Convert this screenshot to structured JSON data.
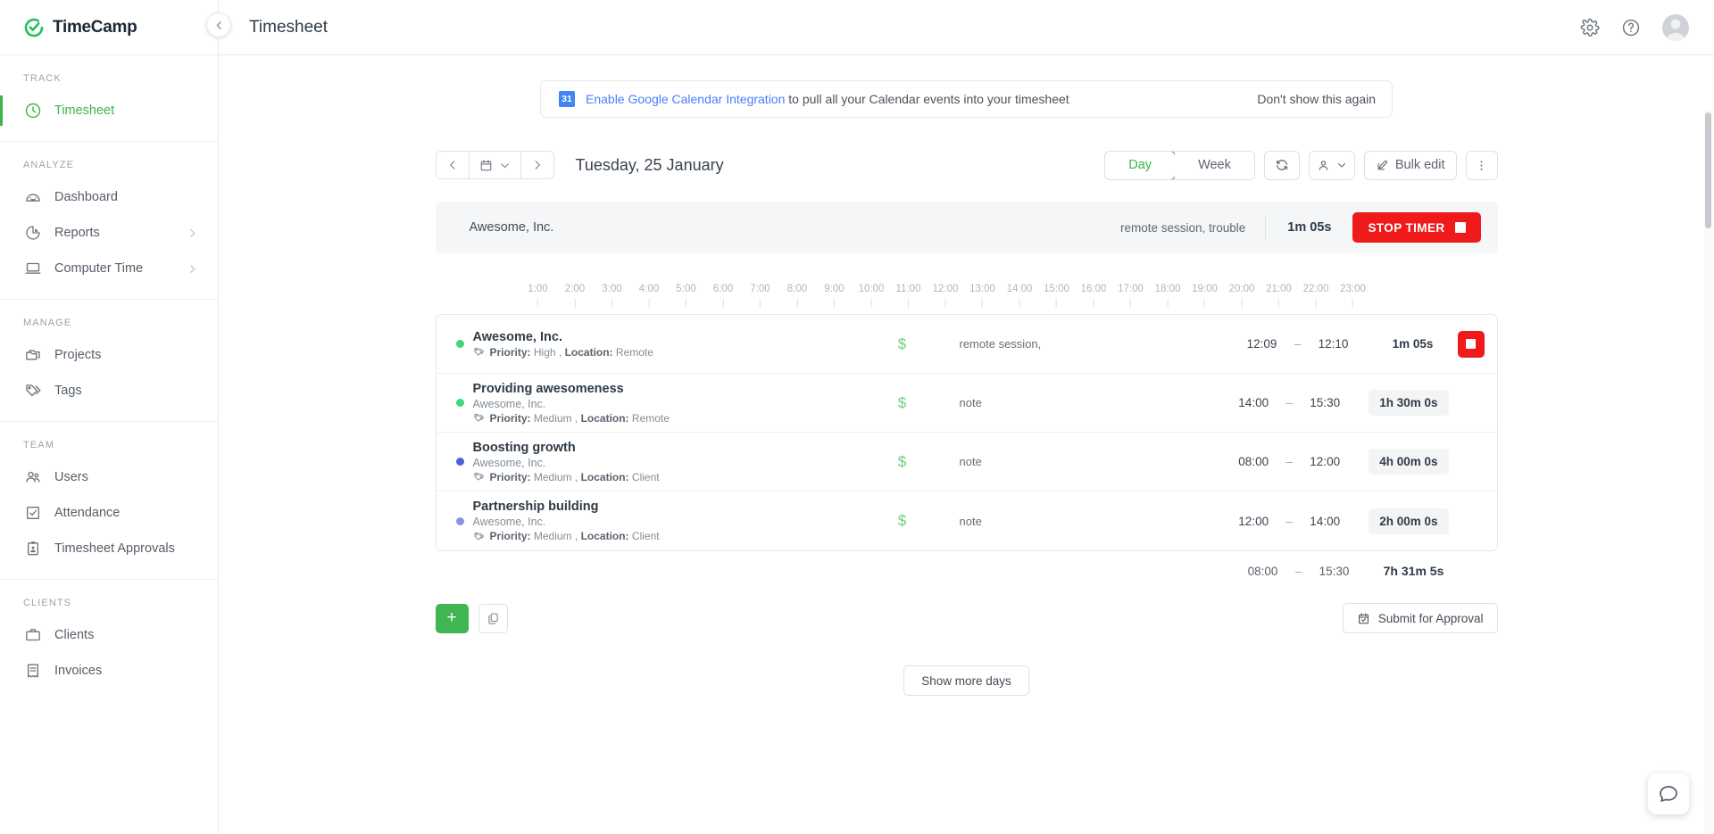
{
  "brand": {
    "name": "TimeCamp",
    "accent": "#3bb54a"
  },
  "sidebar": {
    "sections": [
      {
        "label": "TRACK",
        "items": [
          {
            "label": "Timesheet",
            "icon": "clock-icon",
            "active": true
          }
        ]
      },
      {
        "label": "ANALYZE",
        "items": [
          {
            "label": "Dashboard",
            "icon": "gauge-icon",
            "active": false
          },
          {
            "label": "Reports",
            "icon": "pie-chart-icon",
            "active": false,
            "chevron": true
          },
          {
            "label": "Computer Time",
            "icon": "laptop-icon",
            "active": false,
            "chevron": true
          }
        ]
      },
      {
        "label": "MANAGE",
        "items": [
          {
            "label": "Projects",
            "icon": "folder-icon",
            "active": false
          },
          {
            "label": "Tags",
            "icon": "tag-icon",
            "active": false
          }
        ]
      },
      {
        "label": "TEAM",
        "items": [
          {
            "label": "Users",
            "icon": "users-icon",
            "active": false
          },
          {
            "label": "Attendance",
            "icon": "checkbox-icon",
            "active": false
          },
          {
            "label": "Timesheet Approvals",
            "icon": "clipboard-person-icon",
            "active": false
          }
        ]
      },
      {
        "label": "CLIENTS",
        "items": [
          {
            "label": "Clients",
            "icon": "briefcase-icon",
            "active": false
          },
          {
            "label": "Invoices",
            "icon": "invoice-icon",
            "active": false
          }
        ]
      }
    ]
  },
  "header": {
    "title": "Timesheet"
  },
  "banner": {
    "badge": "31",
    "link": "Enable Google Calendar Integration",
    "rest": " to pull all your Calendar events into your timesheet",
    "dismiss": "Don't show this again"
  },
  "toolbar": {
    "date_label": "Tuesday, 25 January",
    "views": [
      {
        "label": "Day",
        "active": true
      },
      {
        "label": "Week",
        "active": false
      }
    ],
    "bulk_edit": "Bulk edit"
  },
  "timer": {
    "project": "Awesome, Inc.",
    "note": "remote session, trouble",
    "duration": "1m 05s",
    "stop_label": "STOP TIMER"
  },
  "ruler": {
    "hours": [
      "1:00",
      "2:00",
      "3:00",
      "4:00",
      "5:00",
      "6:00",
      "7:00",
      "8:00",
      "9:00",
      "10:00",
      "11:00",
      "12:00",
      "13:00",
      "14:00",
      "15:00",
      "16:00",
      "17:00",
      "18:00",
      "19:00",
      "20:00",
      "21:00",
      "22:00",
      "23:00"
    ]
  },
  "entries": [
    {
      "title": "Awesome, Inc.",
      "subtitle": "",
      "tags": "Priority: High , Location: Remote",
      "tag_priority_label": "Priority:",
      "tag_priority_value": "High",
      "tag_location_label": "Location:",
      "tag_location_value": "Remote",
      "dot_color": "#3fd67e",
      "billable": "$",
      "note": "remote session,",
      "start": "12:09",
      "dash": "–",
      "end": "12:10",
      "duration": "1m 05s",
      "running": true
    },
    {
      "title": "Providing awesomeness",
      "subtitle": "Awesome, Inc.",
      "tags": "Priority: Medium , Location: Remote",
      "tag_priority_label": "Priority:",
      "tag_priority_value": "Medium",
      "tag_location_label": "Location:",
      "tag_location_value": "Remote",
      "dot_color": "#3fd67e",
      "billable": "$",
      "note": "note",
      "start": "14:00",
      "dash": "–",
      "end": "15:30",
      "duration": "1h 30m 0s",
      "running": false
    },
    {
      "title": "Boosting growth",
      "subtitle": "Awesome, Inc.",
      "tags": "Priority: Medium , Location: Client",
      "tag_priority_label": "Priority:",
      "tag_priority_value": "Medium",
      "tag_location_label": "Location:",
      "tag_location_value": "Client",
      "dot_color": "#4a63d8",
      "billable": "$",
      "note": "note",
      "start": "08:00",
      "dash": "–",
      "end": "12:00",
      "duration": "4h 00m 0s",
      "running": false
    },
    {
      "title": "Partnership building",
      "subtitle": "Awesome, Inc.",
      "tags": "Priority: Medium , Location: Client",
      "tag_priority_label": "Priority:",
      "tag_priority_value": "Medium",
      "tag_location_label": "Location:",
      "tag_location_value": "Client",
      "dot_color": "#8b92e0",
      "billable": "$",
      "note": "note",
      "start": "12:00",
      "dash": "–",
      "end": "14:00",
      "duration": "2h 00m 0s",
      "running": false
    }
  ],
  "totals": {
    "start": "08:00",
    "dash": "–",
    "end": "15:30",
    "duration": "7h 31m 5s"
  },
  "footer": {
    "add": "+",
    "submit": "Submit for Approval",
    "show_more": "Show more days"
  }
}
